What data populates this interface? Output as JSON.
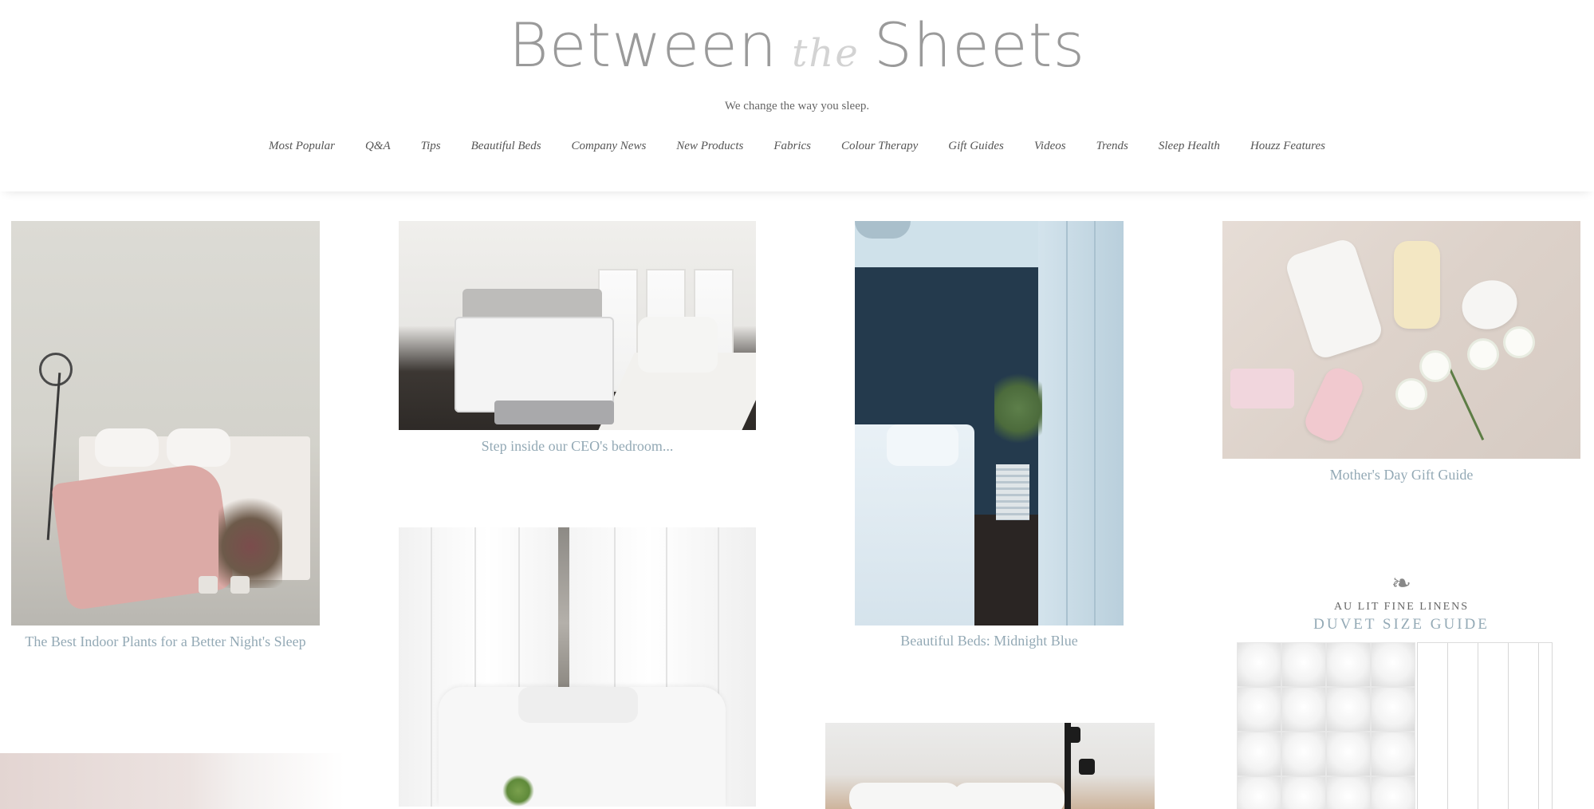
{
  "header": {
    "logo_part1": "Between",
    "logo_part2": "the",
    "logo_part3": "Sheets",
    "tagline": "We change the way you sleep."
  },
  "nav": {
    "items": [
      {
        "label": "Most Popular"
      },
      {
        "label": "Q&A"
      },
      {
        "label": "Tips"
      },
      {
        "label": "Beautiful Beds"
      },
      {
        "label": "Company News"
      },
      {
        "label": "New Products"
      },
      {
        "label": "Fabrics"
      },
      {
        "label": "Colour Therapy"
      },
      {
        "label": "Gift Guides"
      },
      {
        "label": "Videos"
      },
      {
        "label": "Trends"
      },
      {
        "label": "Sleep Health"
      },
      {
        "label": "Houzz Features"
      }
    ]
  },
  "posts": {
    "plants": {
      "caption": "The Best Indoor Plants for a Better Night's Sleep"
    },
    "ceo": {
      "caption": "Step inside our CEO's bedroom..."
    },
    "blue": {
      "caption": "Beautiful Beds: Midnight Blue"
    },
    "mother": {
      "caption": "Mother's Day Gift Guide"
    },
    "duvet": {
      "brand": "AU LIT FINE LINENS",
      "title": "DUVET SIZE GUIDE"
    }
  }
}
